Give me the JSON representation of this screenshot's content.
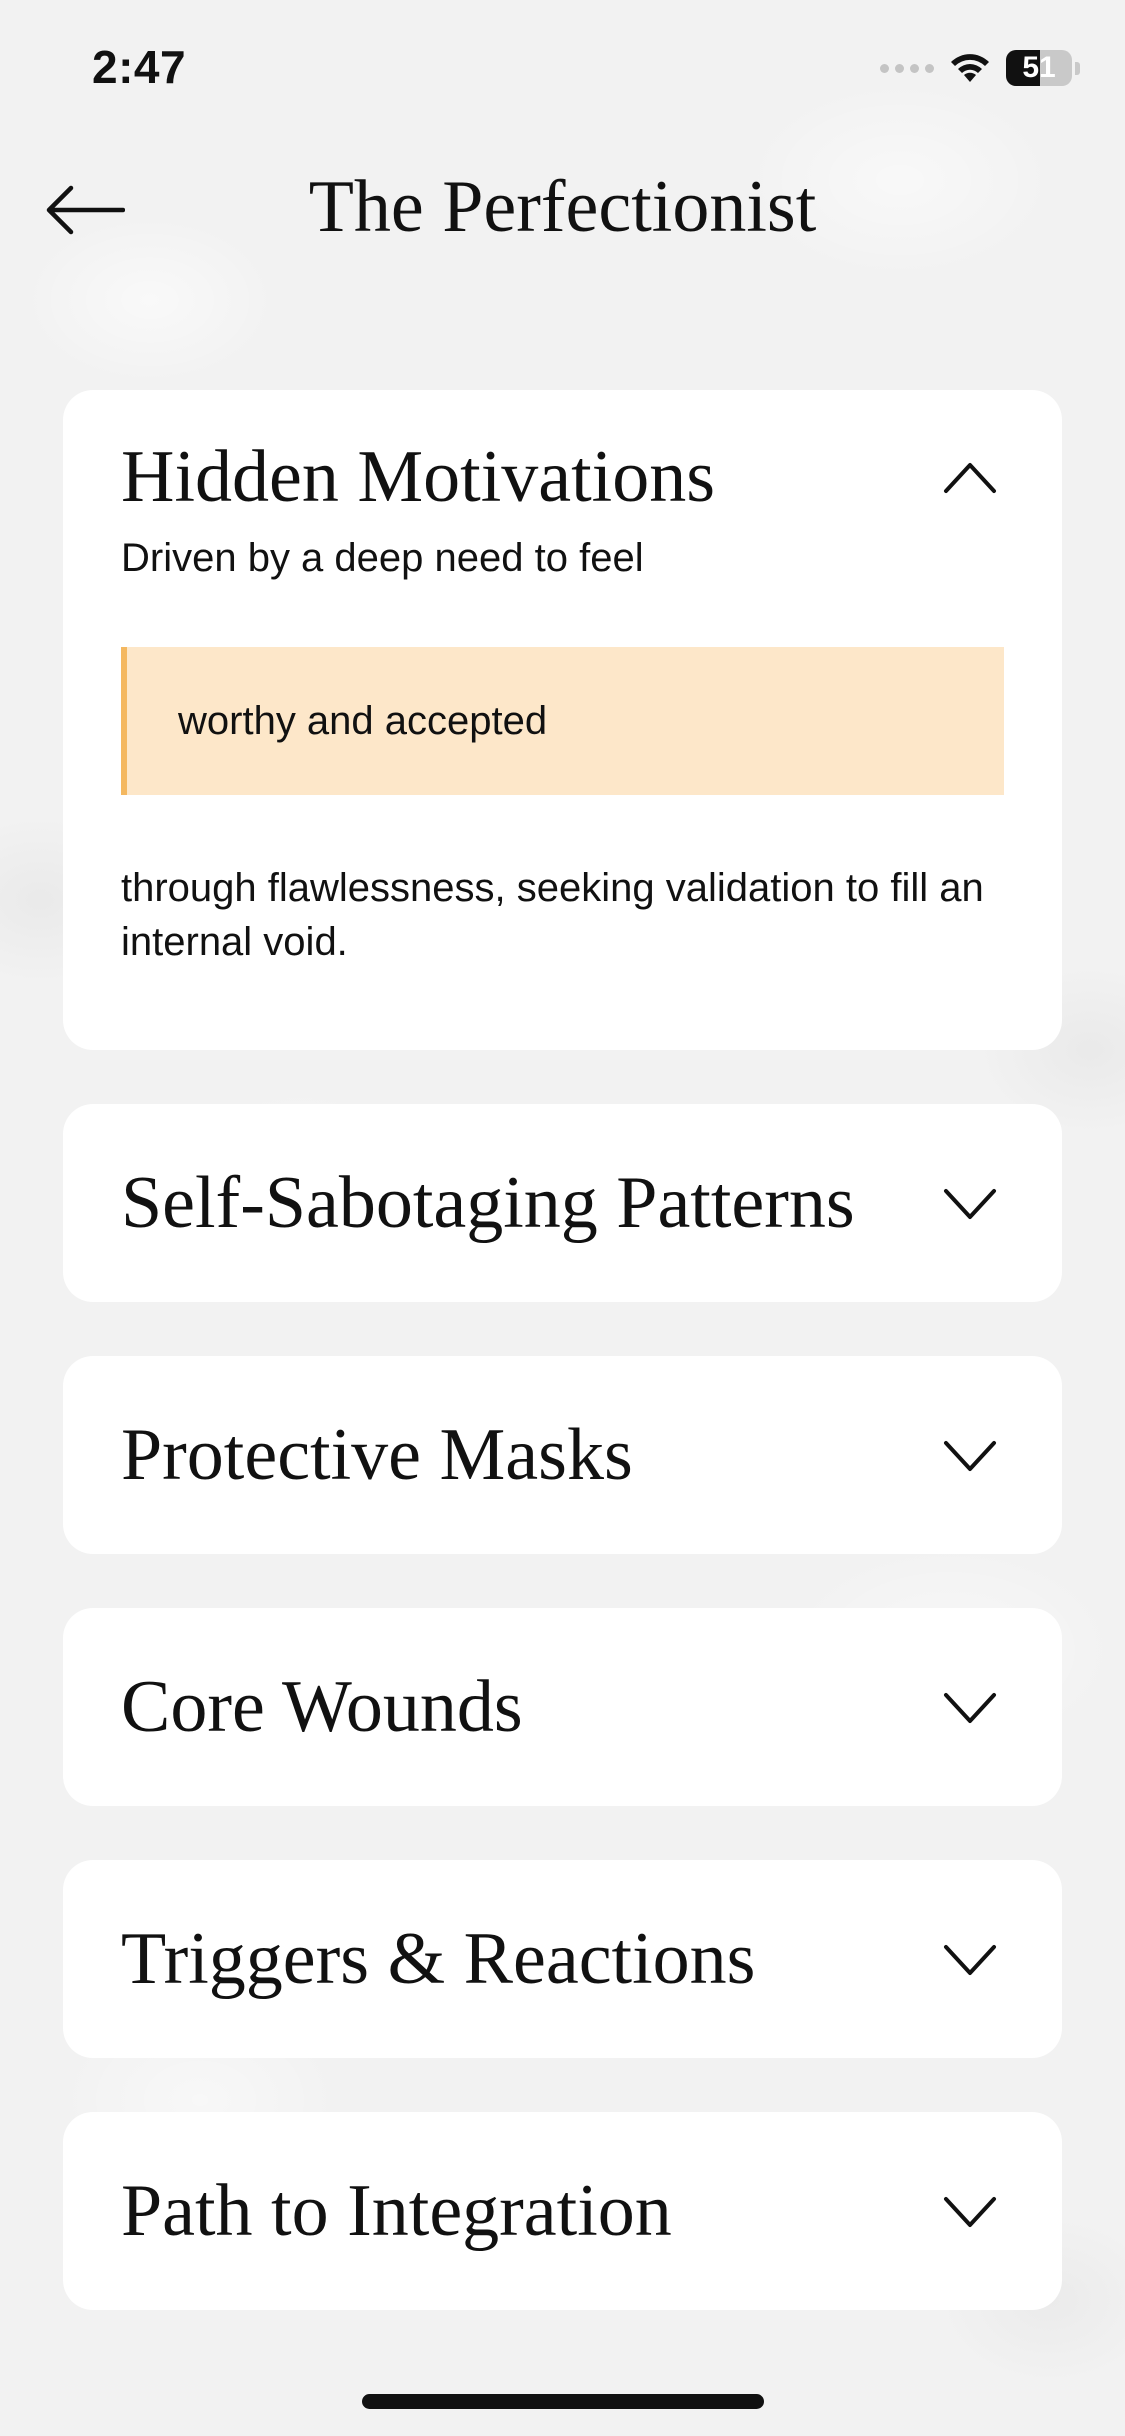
{
  "status_bar": {
    "time": "2:47",
    "battery": "51"
  },
  "header": {
    "title": "The Perfectionist",
    "back_icon": "arrow-left-icon"
  },
  "sections": {
    "expanded": {
      "title": "Hidden Motivations",
      "chevron_icon": "chevron-up-icon",
      "lead": "Driven by a deep need to feel",
      "highlight": "worthy and accepted",
      "body": "through flawlessness, seeking validation to fill an internal void."
    },
    "collapsed": [
      {
        "title": "Self-Sabotaging Patterns",
        "chevron_icon": "chevron-down-icon"
      },
      {
        "title": "Protective Masks",
        "chevron_icon": "chevron-down-icon"
      },
      {
        "title": "Core Wounds",
        "chevron_icon": "chevron-down-icon"
      },
      {
        "title": "Triggers & Reactions",
        "chevron_icon": "chevron-down-icon"
      },
      {
        "title": "Path to Integration",
        "chevron_icon": "chevron-down-icon"
      }
    ]
  },
  "colors": {
    "background": "#f2f2f2",
    "card": "#ffffff",
    "highlight_fill": "#fde7c9",
    "highlight_accent": "#f4b860",
    "text": "#111111"
  }
}
